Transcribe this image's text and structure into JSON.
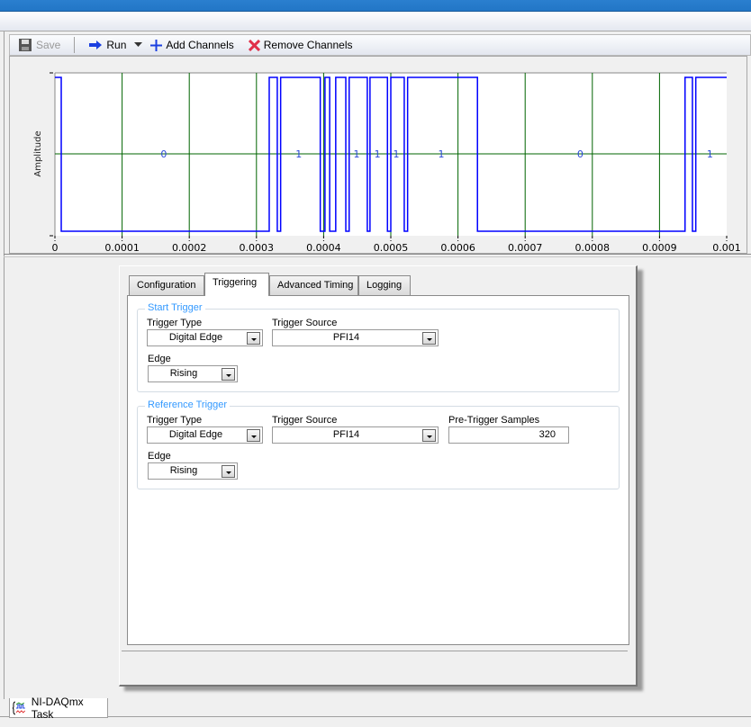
{
  "toolbar": {
    "save_label": "Save",
    "run_label": "Run",
    "add_channels_label": "Add Channels",
    "remove_channels_label": "Remove Channels"
  },
  "chart_data": {
    "type": "line",
    "ylabel": "Amplitude",
    "xlim": [
      0,
      0.001
    ],
    "x_ticks": [
      "0",
      "0.0001",
      "0.0002",
      "0.0003",
      "0.0004",
      "0.0005",
      "0.0006",
      "0.0007",
      "0.0008",
      "0.0009",
      "0.001"
    ],
    "grid": true,
    "line_color": "#0000ff",
    "grid_color": "#006400",
    "series": [
      {
        "transitions": [
          [
            0,
            1
          ],
          [
            9.4e-06,
            0
          ],
          [
            0.000319,
            1
          ],
          [
            0.000331,
            0
          ],
          [
            0.000336,
            1
          ],
          [
            0.000395,
            0
          ],
          [
            0.000402,
            1
          ],
          [
            0.000409,
            0
          ],
          [
            0.000418,
            1
          ],
          [
            0.000433,
            0
          ],
          [
            0.000438,
            1
          ],
          [
            0.000465,
            0
          ],
          [
            0.000469,
            1
          ],
          [
            0.000495,
            0
          ],
          [
            0.0005,
            1
          ],
          [
            0.00052,
            0
          ],
          [
            0.000525,
            1
          ],
          [
            0.000629,
            0
          ],
          [
            0.000938,
            1
          ],
          [
            0.000949,
            0
          ],
          [
            0.000954,
            1
          ]
        ]
      }
    ],
    "annotations": [
      {
        "x": 0.000162,
        "text": "0"
      },
      {
        "x": 0.000363,
        "text": "1"
      },
      {
        "x": 0.000449,
        "text": "1"
      },
      {
        "x": 0.00048,
        "text": "1"
      },
      {
        "x": 0.000508,
        "text": "1"
      },
      {
        "x": 0.000575,
        "text": "1"
      },
      {
        "x": 0.000782,
        "text": "0"
      },
      {
        "x": 0.000975,
        "text": "1"
      }
    ]
  },
  "tabs": [
    "Configuration",
    "Triggering",
    "Advanced Timing",
    "Logging"
  ],
  "active_tab": "Triggering",
  "start_trigger": {
    "title": "Start Trigger",
    "trigger_type_label": "Trigger Type",
    "trigger_type": "Digital Edge",
    "trigger_source_label": "Trigger Source",
    "trigger_source": "PFI14",
    "edge_label": "Edge",
    "edge": "Rising"
  },
  "reference_trigger": {
    "title": "Reference Trigger",
    "trigger_type_label": "Trigger Type",
    "trigger_type": "Digital Edge",
    "trigger_source_label": "Trigger Source",
    "trigger_source": "PFI14",
    "pretrigger_label": "Pre-Trigger Samples",
    "pretrigger_samples": "320",
    "edge_label": "Edge",
    "edge": "Rising"
  },
  "document_tab": "NI-DAQmx Task"
}
